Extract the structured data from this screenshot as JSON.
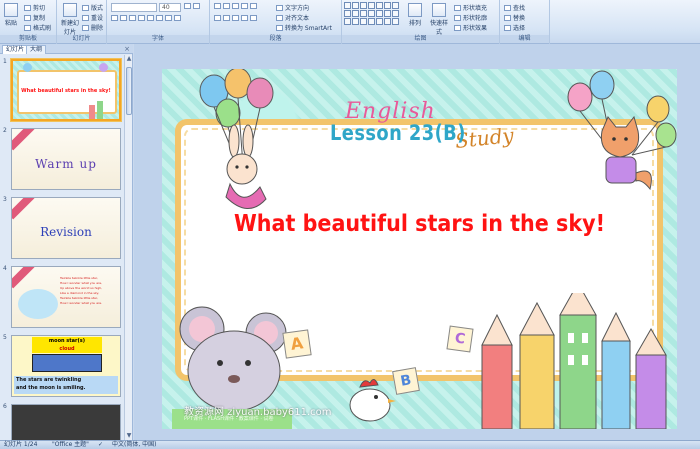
{
  "ribbon": {
    "clipboard": {
      "group_label": "剪贴板",
      "paste": "粘贴",
      "cut": "剪切",
      "copy": "复制",
      "format_painter": "格式刷"
    },
    "slides": {
      "group_label": "幻灯片",
      "new_slide": "新建幻灯片",
      "layout": "版式",
      "reset": "重设",
      "delete": "删除"
    },
    "font": {
      "group_label": "字体",
      "font_size": "40"
    },
    "paragraph": {
      "group_label": "段落",
      "text_direction": "文字方向",
      "align_text": "对齐文本",
      "convert_smartart": "转换为 SmartArt"
    },
    "drawing": {
      "group_label": "绘图",
      "arrange": "排列",
      "quick_styles": "快速样式",
      "shape_fill": "形状填充",
      "shape_outline": "形状轮廓",
      "shape_effects": "形状效果"
    },
    "editing": {
      "group_label": "编辑",
      "find": "查找",
      "replace": "替换",
      "select": "选择"
    }
  },
  "left_panel": {
    "tabs": [
      "幻灯片",
      "大纲"
    ],
    "close": "×",
    "thumbnails": [
      {
        "num": "1",
        "text": "What beautiful stars in the sky!",
        "selected": true
      },
      {
        "num": "2",
        "text": "Warm up"
      },
      {
        "num": "3",
        "text": "Revision"
      },
      {
        "num": "4",
        "lines": [
          "Twinkle twinkle little star,",
          "How I wonder what you are,",
          "Up above the world so high,",
          "Like a diamond in the sky,",
          "Twinkle twinkle little star,",
          "How I wonder what you are."
        ]
      },
      {
        "num": "5",
        "top_label": "moon  star(s)",
        "cloud_label": "cloud",
        "caption_line1": "The stars are twinkling",
        "caption_line2": "and the moon is smiling."
      },
      {
        "num": "6"
      }
    ]
  },
  "slide": {
    "english_logo": "English",
    "study_logo": "Study",
    "lesson": "Lesson 23(B)",
    "title": "What beautiful stars in the sky!",
    "watermark": "教资源网 ziyuan.baby611.com",
    "watermark_sub": "PPT课件 · FLASH课件 · 教案课件 · 试卷",
    "letters": [
      "A",
      "B",
      "C"
    ]
  },
  "status": {
    "slide_pos": "幻灯片 1/24",
    "theme": "\"Office 主题\"",
    "language": "中文(简体, 中国)"
  },
  "colors": {
    "title_red": "#ff1313",
    "lesson_blue": "#2fa6c8",
    "frame_gold": "#f2c46b",
    "selection_orange": "#f5a623"
  }
}
